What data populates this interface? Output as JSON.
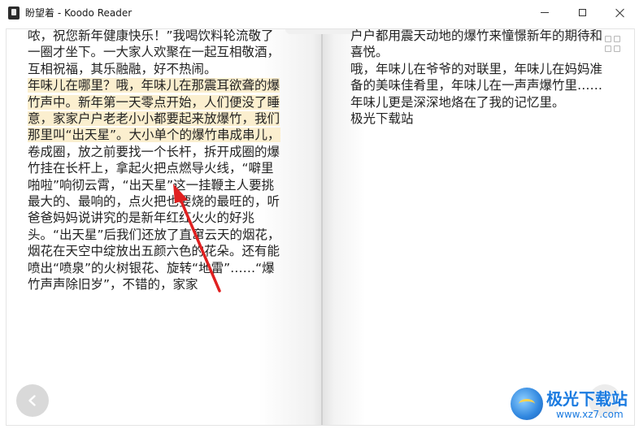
{
  "window": {
    "title": "盼望着 - Koodo Reader",
    "icon": "koodo-app-icon",
    "controls": [
      "minimize-icon",
      "maximize-icon",
      "close-icon"
    ]
  },
  "reader": {
    "left_page": {
      "paragraphs": [
        {
          "text": "哝，祝您新年健康快乐！”我喝饮料轮流敬了一圈才坐下。一大家人欢聚在一起互相敬酒，互相祝福，其乐融融，好不热闹。",
          "highlighted": false
        },
        {
          "text": "年味儿在哪里？哦，年味儿在那震耳欲聋的爆竹声中。新年第一天零点开始，人们便没了睡意，家家户户老老小小都要起来放爆竹，我们那里叫“出天星”。大小单个的爆竹串成串儿，",
          "highlighted": true
        },
        {
          "text": "卷成圈，放之前要找一个长杆，拆开成圈的爆竹挂在长杆上，拿起火把点燃导火线，“噼里啪啦”响彻云霄，“出天星”这一挂鞭主人要挑最大的、最响的，点火把也要烧的最旺的，听爸爸妈妈说讲究的是新年红红火火的好兆头。“出天星”后我们还放了直窜云天的烟花，烟花在天空中绽放出五颜六色的花朵。还有能喷出“喷泉”的火树银花、旋转“地雷”……“爆竹声声除旧岁”，不错的，家家",
          "highlighted": false
        }
      ]
    },
    "right_page": {
      "paragraphs": [
        {
          "text": "户户都用震天动地的爆竹来憧憬新年的期待和喜悦。"
        },
        {
          "text": "哦，年味儿在爷爷的对联里，年味儿在妈妈准备的美味佳肴里，年味儿在一声声爆竹里……年味儿更是深深地烙在了我的记忆里。"
        },
        {
          "text": "极光下载站"
        }
      ]
    },
    "highlight_color": "#fbefcf",
    "annotation_arrow_color": "#e02020",
    "view_mode_icon": "grid-icon",
    "prev_page_icon": "chevron-left-icon",
    "next_page_icon": "chevron-right-icon"
  },
  "watermark": {
    "brand": "极光下载站",
    "url": "www.xz7.com",
    "logo": "aurora-logo-icon"
  }
}
